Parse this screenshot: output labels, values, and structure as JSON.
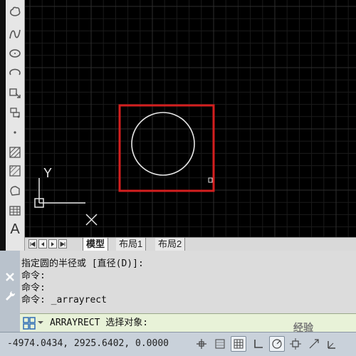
{
  "layout_tabs": {
    "model": "模型",
    "layout1": "布局1",
    "layout2": "布局2"
  },
  "ucs": {
    "y_label": "Y",
    "x_label": "X"
  },
  "command_history": [
    "指定圆的半径或 [直径(D)]:",
    "命令:",
    "命令:",
    "命令: _arrayrect"
  ],
  "command_prompt": "ARRAYRECT 选择对象:",
  "status": {
    "coordinates": "-4974.0434, 2925.6402, 0.0000"
  },
  "watermark": "经验",
  "colors": {
    "canvas_bg": "#000000",
    "grid_minor": "#1b1b1b",
    "grid_major": "#2e2e2e",
    "selection_rect": "#d41f1f",
    "circle": "#e6e6e6",
    "command_input_bg": "#e8f2d8"
  },
  "icons": {
    "toolbar": [
      "revcloud-icon",
      "spline-icon",
      "ellipse-icon",
      "ellipse-arc-icon",
      "insert-block-icon",
      "make-block-icon",
      "point-icon",
      "hatch-icon",
      "gradient-icon",
      "region-icon",
      "table-icon",
      "multiline-text-icon"
    ]
  }
}
